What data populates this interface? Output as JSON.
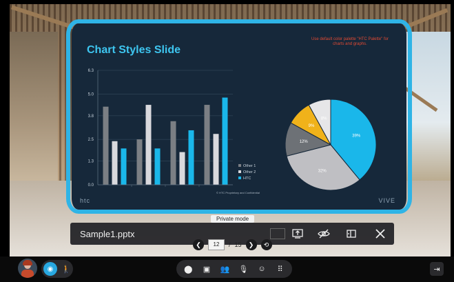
{
  "slide": {
    "title": "Chart Styles Slide",
    "note": "Use default color palette \"HTC Palette\" for charts and graphs.",
    "brand_left": "htc",
    "brand_right": "VIVE",
    "footer": "© HTC Proprietary and Confidential"
  },
  "chart_data": [
    {
      "type": "bar",
      "categories": [
        "1",
        "2",
        "3",
        "4"
      ],
      "series": [
        {
          "name": "Other 1",
          "color": "#7b7f84",
          "values": [
            4.3,
            2.5,
            3.5,
            4.4
          ]
        },
        {
          "name": "Other 2",
          "color": "#d9d9dd",
          "values": [
            2.4,
            4.4,
            1.8,
            2.8
          ]
        },
        {
          "name": "HTC",
          "color": "#1ab7ea",
          "values": [
            2.0,
            2.0,
            3.0,
            4.8
          ]
        }
      ],
      "yticks": [
        "6.3",
        "5.0",
        "3.8",
        "2.5",
        "1.3",
        "0.0"
      ],
      "ylim": [
        0,
        6.3
      ],
      "grid": true,
      "legend": "right"
    },
    {
      "type": "pie",
      "slices": [
        {
          "label": "39%",
          "value": 39,
          "color": "#1ab7ea"
        },
        {
          "label": "32%",
          "value": 32,
          "color": "#bfbfc3"
        },
        {
          "label": "12%",
          "value": 12,
          "color": "#6d7176"
        },
        {
          "label": "9%",
          "value": 9,
          "color": "#f0b21a"
        },
        {
          "label": "8%",
          "value": 8,
          "color": "#e6e6e8"
        }
      ]
    }
  ],
  "controls": {
    "private_mode": "Private mode",
    "filename": "Sample1.pptx",
    "page_current": "12",
    "page_sep": "/",
    "page_total": "15"
  },
  "icons": {
    "share": "share-screen-icon",
    "hide": "hide-icon",
    "fit": "fit-screen-icon",
    "close": "close-icon"
  }
}
